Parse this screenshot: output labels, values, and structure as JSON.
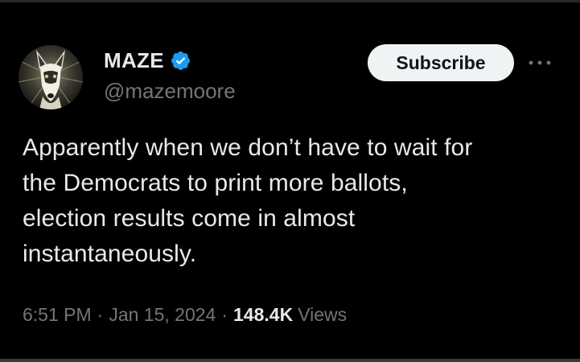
{
  "author": {
    "display_name": "MAZE",
    "handle": "@mazemoore",
    "verified": true,
    "verified_color": "#1d9bf0"
  },
  "actions": {
    "subscribe_label": "Subscribe",
    "more_icon": "ellipsis-icon"
  },
  "tweet": {
    "text": "Apparently when we don’t have to wait for\nthe Democrats to print more ballots,\nelection results come in almost\ninstantaneously."
  },
  "meta": {
    "time": "6:51 PM",
    "separator": "·",
    "date": "Jan 15, 2024",
    "views_count": "148.4K",
    "views_label": "Views"
  },
  "colors": {
    "background": "#000000",
    "primary_text": "#e7e9ea",
    "secondary_text": "#71767b",
    "button_bg": "#eff3f4"
  }
}
